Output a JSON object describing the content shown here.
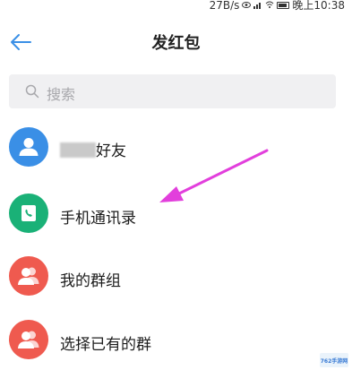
{
  "status_bar": {
    "network_speed": "27B/s",
    "time": "晚上10:38"
  },
  "header": {
    "title": "发红包",
    "back_icon": "arrow-left-icon"
  },
  "search": {
    "placeholder": "搜索",
    "icon": "search-icon"
  },
  "list": {
    "items": [
      {
        "label": "好友",
        "icon": "person-icon",
        "color": "#3a8fe6"
      },
      {
        "label": "手机通讯录",
        "icon": "phone-book-icon",
        "color": "#1ab177"
      },
      {
        "label": "我的群组",
        "icon": "group-icon",
        "color": "#ef5a4f"
      },
      {
        "label": "选择已有的群",
        "icon": "group-icon",
        "color": "#ef5a4f"
      }
    ]
  },
  "annotation": {
    "arrow_color": "#e23fdc"
  },
  "watermark": {
    "text": "762手游网"
  },
  "colors": {
    "accent": "#3a8fe6",
    "search_bg": "#f0f0f2"
  }
}
